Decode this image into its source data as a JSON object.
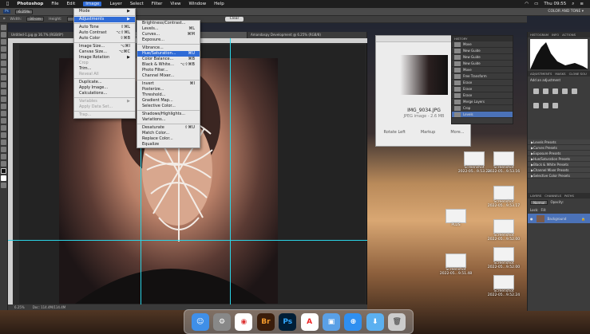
{
  "menubar": {
    "app": "Photoshop",
    "items": [
      "File",
      "Edit",
      "Image",
      "Layer",
      "Select",
      "Filter",
      "View",
      "Window",
      "Help"
    ],
    "active": "Image",
    "clock": "Thu 09:55"
  },
  "options_bar": {
    "zoom": "6.25%",
    "width_label": "Width:",
    "width_value": "30 cm",
    "height_label": "Height:",
    "clear_label": "Clear",
    "right_label": "COLOR AND TONE ▾"
  },
  "tabs": [
    "Untitled-1.jpg @ 16.7% (RGB/8*)",
    "IMG_9034.JPG @ 6.25% (RGB/8) *",
    "Amandaspy Development @ 6.25% (RGB/8)"
  ],
  "status": {
    "zoom": "6.25%",
    "doc": "Doc: 114.4M/114.4M"
  },
  "image_menu": {
    "items": [
      {
        "label": "Mode",
        "shortcut": "▶",
        "disabled": false
      },
      {
        "sep": true
      },
      {
        "label": "Adjustments",
        "shortcut": "▶",
        "selected": true
      },
      {
        "sep": true
      },
      {
        "label": "Auto Tone",
        "shortcut": "⇧⌘L"
      },
      {
        "label": "Auto Contrast",
        "shortcut": "⌥⇧⌘L"
      },
      {
        "label": "Auto Color",
        "shortcut": "⇧⌘B"
      },
      {
        "sep": true
      },
      {
        "label": "Image Size...",
        "shortcut": "⌥⌘I"
      },
      {
        "label": "Canvas Size...",
        "shortcut": "⌥⌘C"
      },
      {
        "label": "Image Rotation",
        "shortcut": "▶"
      },
      {
        "label": "Crop",
        "shortcut": "",
        "disabled": true
      },
      {
        "label": "Trim...",
        "shortcut": ""
      },
      {
        "label": "Reveal All",
        "shortcut": "",
        "disabled": true
      },
      {
        "sep": true
      },
      {
        "label": "Duplicate...",
        "shortcut": ""
      },
      {
        "label": "Apply Image...",
        "shortcut": ""
      },
      {
        "label": "Calculations...",
        "shortcut": ""
      },
      {
        "sep": true
      },
      {
        "label": "Variables",
        "shortcut": "▶",
        "disabled": true
      },
      {
        "label": "Apply Data Set...",
        "shortcut": "",
        "disabled": true
      },
      {
        "sep": true
      },
      {
        "label": "Trap...",
        "shortcut": "",
        "disabled": true
      }
    ]
  },
  "adjust_menu": {
    "items": [
      {
        "label": "Brightness/Contrast...",
        "shortcut": ""
      },
      {
        "label": "Levels...",
        "shortcut": "⌘L"
      },
      {
        "label": "Curves...",
        "shortcut": "⌘M"
      },
      {
        "label": "Exposure...",
        "shortcut": ""
      },
      {
        "sep": true
      },
      {
        "label": "Vibrance...",
        "shortcut": ""
      },
      {
        "label": "Hue/Saturation...",
        "shortcut": "⌘U",
        "selected": true
      },
      {
        "label": "Color Balance...",
        "shortcut": "⌘B"
      },
      {
        "label": "Black & White...",
        "shortcut": "⌥⇧⌘B"
      },
      {
        "label": "Photo Filter...",
        "shortcut": ""
      },
      {
        "label": "Channel Mixer...",
        "shortcut": ""
      },
      {
        "sep": true
      },
      {
        "label": "Invert",
        "shortcut": "⌘I"
      },
      {
        "label": "Posterize...",
        "shortcut": ""
      },
      {
        "label": "Threshold...",
        "shortcut": ""
      },
      {
        "label": "Gradient Map...",
        "shortcut": ""
      },
      {
        "label": "Selective Color...",
        "shortcut": ""
      },
      {
        "sep": true
      },
      {
        "label": "Shadows/Highlights...",
        "shortcut": ""
      },
      {
        "label": "Variations...",
        "shortcut": ""
      },
      {
        "sep": true
      },
      {
        "label": "Desaturate",
        "shortcut": "⇧⌘U"
      },
      {
        "label": "Match Color...",
        "shortcut": ""
      },
      {
        "label": "Replace Color...",
        "shortcut": ""
      },
      {
        "label": "Equalize",
        "shortcut": ""
      }
    ]
  },
  "finder": {
    "filename": "IMG_9034.JPG",
    "kind": "JPEG image - 2.6 MB",
    "actions": [
      "Rotate Left",
      "Markup",
      "More..."
    ]
  },
  "history": {
    "title": "HISTORY",
    "items": [
      "Move",
      "New Guide",
      "New Guide",
      "New Guide",
      "Move",
      "Free Transform",
      "Erase",
      "Erase",
      "Erase",
      "Merge Layers",
      "Crop",
      "Levels"
    ],
    "selected": "Levels"
  },
  "right_panel": {
    "tabs1": [
      "HISTOGRAM",
      "INFO",
      "ACTIONS"
    ],
    "tabs2": [
      "ADJUSTMENTS",
      "MASKS",
      "CLONE SOU"
    ],
    "add_label": "Add an adjustment",
    "presets": [
      "Levels Presets",
      "Curves Presets",
      "Exposure Presets",
      "Hue/Saturation Presets",
      "Black & White Presets",
      "Channel Mixer Presets",
      "Selective Color Presets"
    ],
    "tabs3": [
      "LAYERS",
      "CHANNELS",
      "PATHS"
    ],
    "blend_mode": "Normal",
    "opacity_label": "Opacity:",
    "lock_label": "Lock:",
    "fill_label": "Fill:",
    "layer_name": "Background"
  },
  "desktop": {
    "items": [
      {
        "line1": "Screenshot",
        "line2": "2022-05...9.53.24"
      },
      {
        "line1": "Screenshot",
        "line2": "2022-05...9.53.16"
      },
      {
        "line1": "Screenshot",
        "line2": "2022-05...9.53.17"
      },
      {
        "line1": "PLUS",
        "line2": ""
      },
      {
        "line1": "Screenshot",
        "line2": "2022-05...9.52.00"
      },
      {
        "line1": "Screenshot",
        "line2": "2022-05...9.52.00"
      },
      {
        "line1": "Screenshot",
        "line2": "2022-05...9.51.48"
      },
      {
        "line1": "Screenshot",
        "line2": "2022-05...9.52.24"
      }
    ]
  },
  "dock": [
    "Finder",
    "System Preferences",
    "Chrome",
    "Br",
    "Ps",
    "Acrobat",
    "Preview",
    "Safari",
    "Downloads",
    "Trash"
  ]
}
